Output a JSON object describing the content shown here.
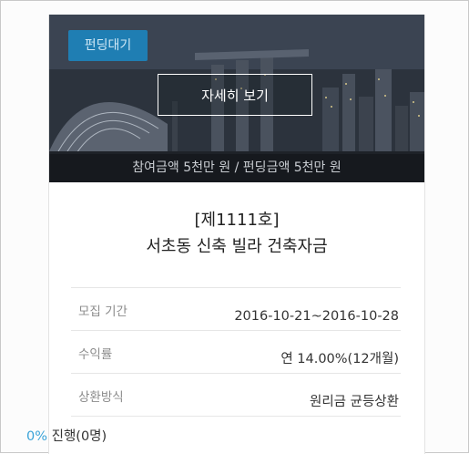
{
  "hero": {
    "status_badge": "펀딩대기",
    "detail_button": "자세히 보기",
    "amount_summary": "참여금액 5천만 원 / 펀딩금액 5천만 원"
  },
  "title": {
    "number": "[제1111호]",
    "name": "서초동 신축 빌라 건축자금"
  },
  "info": [
    {
      "label": "모집 기간",
      "value": "2016-10-21~2016-10-28"
    },
    {
      "label": "수익률",
      "value": "연 14.00%(12개월)"
    },
    {
      "label": "상환방식",
      "value": "원리금 균등상환"
    }
  ],
  "progress": {
    "percent": "0%",
    "text": "진행(0명)"
  },
  "colors": {
    "badge_bg": "#1f7eb3",
    "accent_percent": "#3aa3d8"
  }
}
